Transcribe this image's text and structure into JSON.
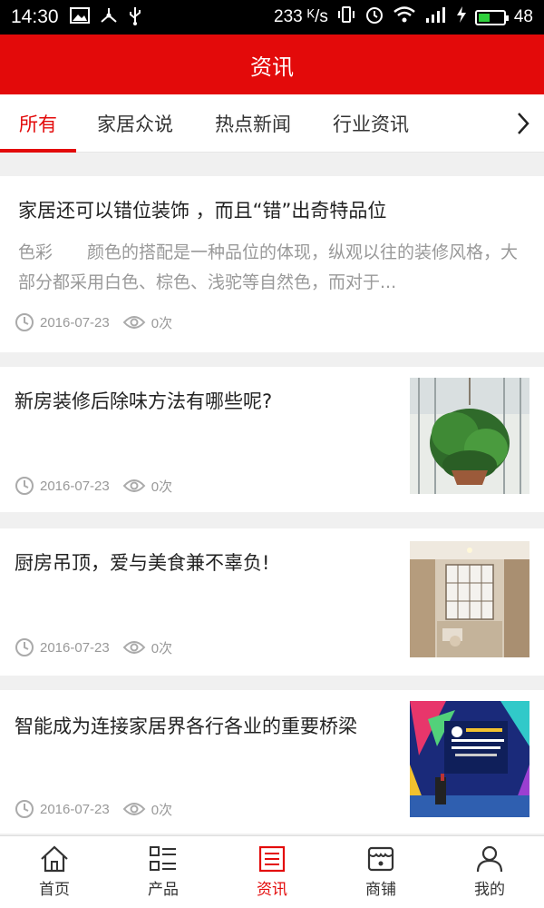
{
  "status_bar": {
    "time": "14:30",
    "speed": "233 ᴷ/s",
    "battery_level": "48",
    "battery_fill": 0.48,
    "icons": [
      "image-icon",
      "usb-tether-icon",
      "usb-icon",
      "vibrate-icon",
      "alarm-icon",
      "wifi-icon",
      "signal-4g-icon",
      "charging-icon",
      "battery-icon"
    ]
  },
  "header": {
    "title": "资讯"
  },
  "tabs": [
    {
      "label": "所有",
      "active": true
    },
    {
      "label": "家居众说"
    },
    {
      "label": "热点新闻"
    },
    {
      "label": "行业资讯"
    }
  ],
  "articles": [
    {
      "title": "家居还可以错位装饰 ，而且“错”出奇特品位",
      "summary": "色彩　　颜色的搭配是一种品位的体现，纵观以往的装修风格，大部分都采用白色、棕色、浅驼等自然色，而对于...",
      "date": "2016-07-23",
      "views": "0次"
    },
    {
      "title": "新房装修后除味方法有哪些呢?",
      "date": "2016-07-23",
      "views": "0次",
      "thumbnail": "plant-photo"
    },
    {
      "title": "厨房吊顶，爱与美食兼不辜负!",
      "date": "2016-07-23",
      "views": "0次",
      "thumbnail": "kitchen-photo"
    },
    {
      "title": "智能成为连接家居界各行各业的重要桥梁",
      "date": "2016-07-23",
      "views": "0次",
      "thumbnail": "forum-stage-photo"
    }
  ],
  "bottom_nav": [
    {
      "label": "首页",
      "icon": "home-icon"
    },
    {
      "label": "产品",
      "icon": "list-icon"
    },
    {
      "label": "资讯",
      "icon": "news-icon",
      "active": true
    },
    {
      "label": "商铺",
      "icon": "shop-icon"
    },
    {
      "label": "我的",
      "icon": "user-icon"
    }
  ],
  "colors": {
    "accent": "#e30a0a",
    "muted": "#999999",
    "background": "#f0f0f0"
  }
}
